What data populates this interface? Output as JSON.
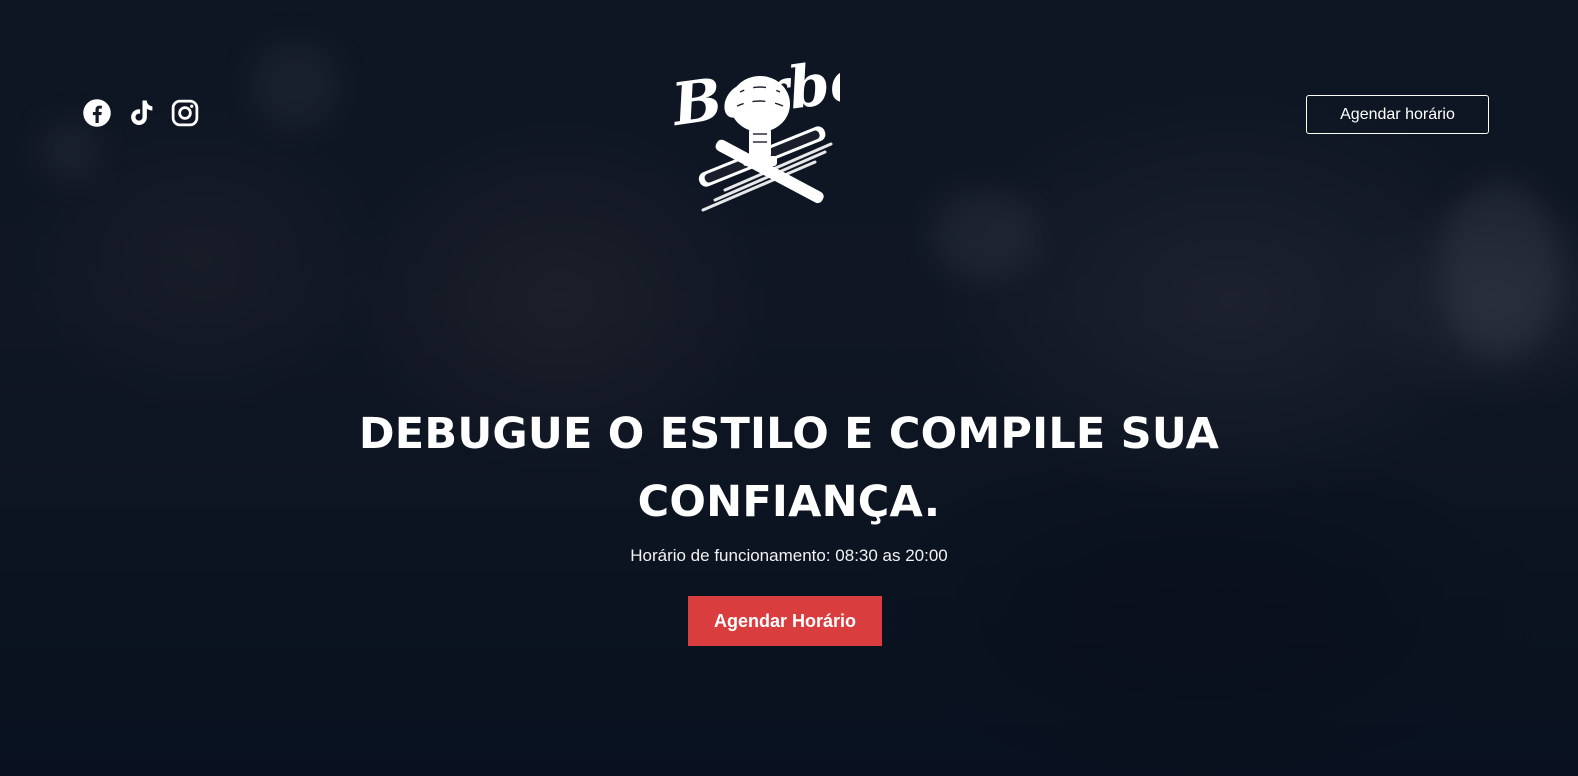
{
  "header": {
    "social": [
      {
        "name": "facebook-icon"
      },
      {
        "name": "tiktok-icon"
      },
      {
        "name": "instagram-icon"
      }
    ],
    "logo": {
      "text": "Barber",
      "icon": "shaving-brush-razor-icon"
    },
    "cta_label": "Agendar horário"
  },
  "hero": {
    "title": "DEBUGUE O ESTILO E COMPILE SUA CONFIANÇA.",
    "hours": "Horário de funcionamento: 08:30 as 20:00",
    "cta_label": "Agendar Horário"
  },
  "colors": {
    "accent": "#d93d3e",
    "overlay": "#0a1220",
    "text": "#ffffff"
  }
}
